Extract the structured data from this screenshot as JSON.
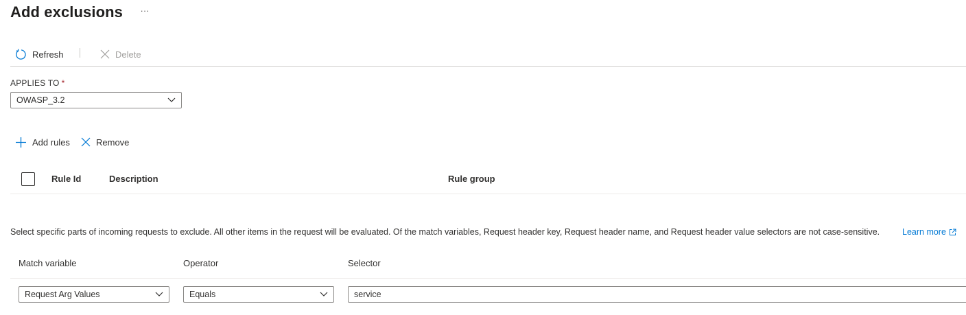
{
  "header": {
    "title": "Add exclusions",
    "more": "···"
  },
  "toolbar": {
    "refresh_label": "Refresh",
    "delete_label": "Delete"
  },
  "applies_to": {
    "label": "APPLIES TO",
    "required": "*",
    "value": "OWASP_3.2"
  },
  "rules_actions": {
    "add_label": "Add rules",
    "remove_label": "Remove"
  },
  "rules_table": {
    "columns": [
      "Rule Id",
      "Description",
      "Rule group"
    ]
  },
  "info": {
    "text": "Select specific parts of incoming requests to exclude. All other items in the request will be evaluated. Of the match variables, Request header key, Request header name, and Request header value selectors are not case-sensitive.",
    "link_label": "Learn more"
  },
  "exclusion_table": {
    "columns": [
      "Match variable",
      "Operator",
      "Selector"
    ],
    "row": {
      "match_variable": "Request Arg Values",
      "operator": "Equals",
      "selector": "service"
    }
  },
  "colors": {
    "accent": "#0078d4",
    "required": "#a4262c",
    "disabled": "#a19f9d"
  },
  "icons": [
    "refresh-icon",
    "close-icon",
    "chevron-down-icon",
    "add-icon",
    "external-link-icon"
  ]
}
